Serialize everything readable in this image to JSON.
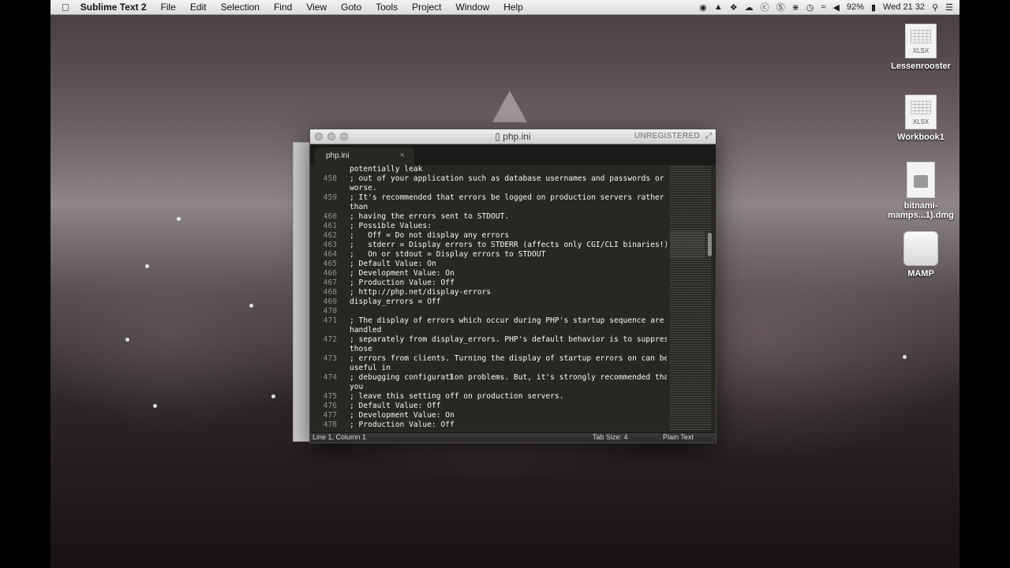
{
  "menubar": {
    "apple_icon": "apple-icon",
    "app_name": "Sublime Text 2",
    "items": [
      "File",
      "Edit",
      "Selection",
      "Find",
      "View",
      "Goto",
      "Tools",
      "Project",
      "Window",
      "Help"
    ],
    "status": {
      "battery": "92%",
      "clock": "Wed 21 32",
      "icons": [
        "record-icon",
        "drive-icon",
        "dropbox-icon",
        "cloud-icon",
        "skype-icon",
        "s-icon",
        "bluetooth-icon",
        "time-machine-icon",
        "wifi-icon",
        "volume-icon",
        "battery-icon",
        "search-icon",
        "list-icon"
      ]
    }
  },
  "desktop": {
    "icons": [
      {
        "label": "Lessenrooster",
        "kind_label": "XLSX"
      },
      {
        "label": "Workbook1",
        "kind_label": "XLSX"
      },
      {
        "label": "bitnami-\nmamps...1).dmg"
      },
      {
        "label": "MAMP"
      }
    ]
  },
  "window": {
    "title": "php.ini",
    "registration": "UNREGISTERED",
    "tab": {
      "label": "php.ini",
      "close": "×"
    },
    "lines": [
      {
        "ln": "",
        "text": "potentially leak"
      },
      {
        "ln": "458",
        "text": "; out of your application such as database usernames and passwords or"
      },
      {
        "ln": "",
        "text": "worse."
      },
      {
        "ln": "459",
        "text": "; It's recommended that errors be logged on production servers rather"
      },
      {
        "ln": "",
        "text": "than"
      },
      {
        "ln": "460",
        "text": "; having the errors sent to STDOUT."
      },
      {
        "ln": "461",
        "text": "; Possible Values:"
      },
      {
        "ln": "462",
        "text": ";   Off = Do not display any errors"
      },
      {
        "ln": "463",
        "text": ";   stderr = Display errors to STDERR (affects only CGI/CLI binaries!)"
      },
      {
        "ln": "464",
        "text": ";   On or stdout = Display errors to STDOUT"
      },
      {
        "ln": "465",
        "text": "; Default Value: On"
      },
      {
        "ln": "466",
        "text": "; Development Value: On"
      },
      {
        "ln": "467",
        "text": "; Production Value: Off"
      },
      {
        "ln": "468",
        "text": "; http://php.net/display-errors"
      },
      {
        "ln": "469",
        "text": "display_errors = Off"
      },
      {
        "ln": "470",
        "text": ""
      },
      {
        "ln": "471",
        "text": "; The display of errors which occur during PHP's startup sequence are"
      },
      {
        "ln": "",
        "text": "handled"
      },
      {
        "ln": "472",
        "text": "; separately from display_errors. PHP's default behavior is to suppress"
      },
      {
        "ln": "",
        "text": "those"
      },
      {
        "ln": "473",
        "text": "; errors from clients. Turning the display of startup errors on can be"
      },
      {
        "ln": "",
        "text": "useful in"
      },
      {
        "ln": "474",
        "text": "; debugging configuration problems. But, it's strongly recommended that"
      },
      {
        "ln": "",
        "text": "you"
      },
      {
        "ln": "475",
        "text": "; leave this setting off on production servers."
      },
      {
        "ln": "476",
        "text": "; Default Value: Off"
      },
      {
        "ln": "477",
        "text": "; Development Value: On"
      },
      {
        "ln": "478",
        "text": "; Production Value: Off"
      }
    ],
    "statusbar": {
      "position": "Line 1, Column 1",
      "tab_size": "Tab Size: 4",
      "syntax": "Plain Text"
    }
  }
}
